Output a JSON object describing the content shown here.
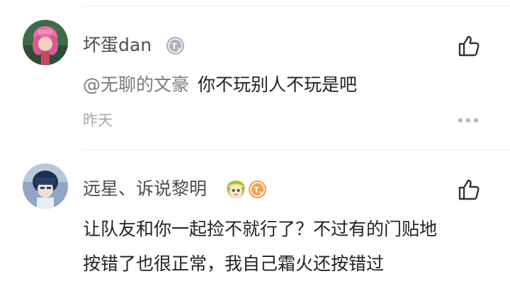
{
  "comments": [
    {
      "username": "坏蛋dan",
      "badge_icon": "gray-level-badge-icon",
      "like_icon": "thumbs-up-icon",
      "mention": "@无聊的文豪",
      "text": "你不玩别人不玩是吧",
      "time": "昨天",
      "more_icon": "ellipsis-icon"
    },
    {
      "username": "远星、诉说黎明",
      "emoji_icon": "anime-face-emoji-icon",
      "badge_icon": "orange-level-badge-icon",
      "like_icon": "thumbs-up-icon",
      "text_lines": [
        "让队友和你一起捡不就行了？不过有的门贴地",
        "按错了也很正常，我自己霜火还按错过"
      ]
    }
  ],
  "colors": {
    "username": "#4d4d4d",
    "mention": "#7b7b7b",
    "text": "#222222",
    "time": "#a8a8a8",
    "divider": "#ececec",
    "badge_gray": "#a9b2bd",
    "badge_orange": "#f3a055"
  }
}
